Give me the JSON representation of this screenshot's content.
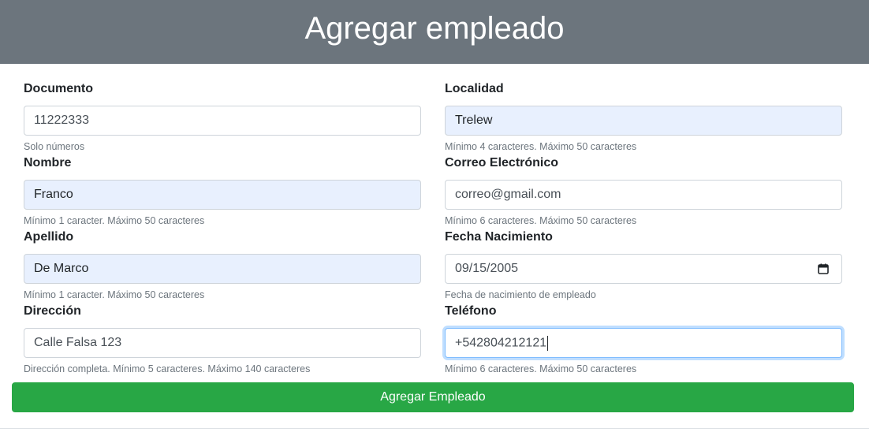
{
  "header": {
    "title": "Agregar empleado"
  },
  "form": {
    "documento": {
      "label": "Documento",
      "value": "11222333",
      "help": "Solo números"
    },
    "nombre": {
      "label": "Nombre",
      "value": "Franco",
      "help": "Mínimo 1 caracter. Máximo 50 caracteres"
    },
    "apellido": {
      "label": "Apellido",
      "value": "De Marco",
      "help": "Mínimo 1 caracter. Máximo 50 caracteres"
    },
    "direccion": {
      "label": "Dirección",
      "value": "Calle Falsa 123",
      "help": "Dirección completa. Mínimo 5 caracteres. Máximo 140 caracteres"
    },
    "localidad": {
      "label": "Localidad",
      "value": "Trelew",
      "help": "Mínimo 4 caracteres. Máximo 50 caracteres"
    },
    "correo": {
      "label": "Correo Electrónico",
      "value": "correo@gmail.com",
      "help": "Mínimo 6 caracteres. Máximo 50 caracteres"
    },
    "fecha": {
      "label": "Fecha Nacimiento",
      "value": "09/15/2005",
      "help": "Fecha de nacimiento de empleado",
      "icon": "calendar-icon"
    },
    "telefono": {
      "label": "Teléfono",
      "value": "+542804212121",
      "help": "Mínimo 6 caracteres. Máximo 50 caracteres"
    }
  },
  "submit": {
    "label": "Agregar Empleado"
  },
  "colors": {
    "header_bg": "#6c757d",
    "submit_bg": "#28a745",
    "autofill_bg": "#e8f0fe",
    "focus_border": "#80bdff"
  }
}
